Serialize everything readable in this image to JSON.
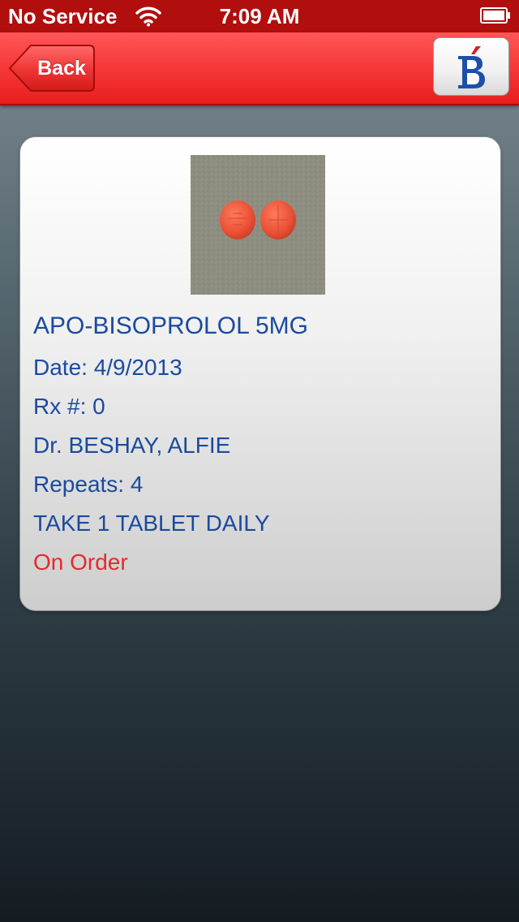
{
  "status_bar": {
    "carrier": "No Service",
    "time": "7:09 AM",
    "icons": [
      "wifi-icon",
      "battery-icon"
    ]
  },
  "nav": {
    "back_label": "Back",
    "logo_icon": "pharmacy-logo-icon"
  },
  "prescription": {
    "image": "pill-photo",
    "name": "APO-BISOPROLOL 5MG",
    "date": "Date: 4/9/2013",
    "rx_number": "Rx #: 0",
    "doctor": "Dr. BESHAY, ALFIE",
    "repeats": "Repeats: 4",
    "instructions": "TAKE 1 TABLET DAILY",
    "status": "On Order"
  },
  "colors": {
    "status_bar": "#b10e0e",
    "nav_bar": "#f73b3b",
    "text_blue": "#1b4a9e",
    "status_red": "#e52a2a"
  }
}
